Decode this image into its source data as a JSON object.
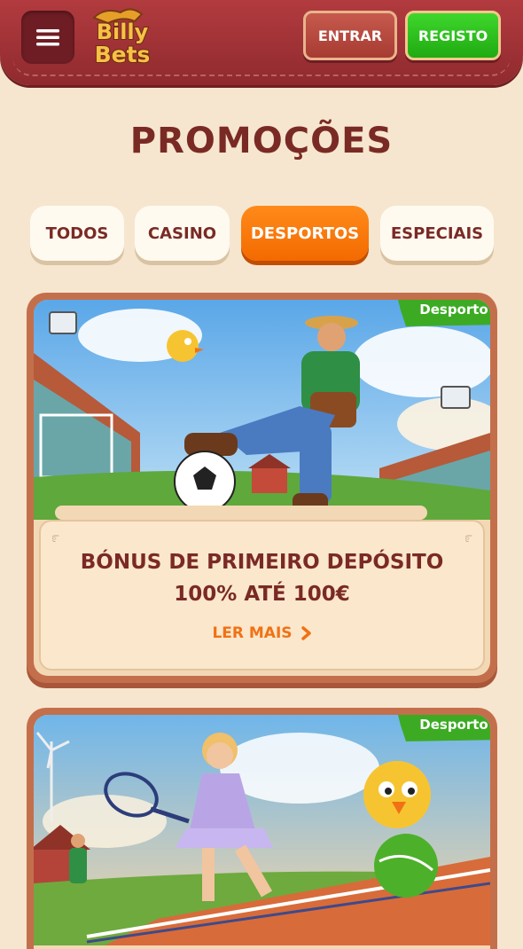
{
  "header": {
    "logo_text_line1": "Billy",
    "logo_text_line2": "Bets",
    "login_label": "ENTRAR",
    "register_label": "REGISTO"
  },
  "page": {
    "title": "PROMOÇÕES"
  },
  "tabs": [
    {
      "label": "TODOS",
      "active": false
    },
    {
      "label": "CASINO",
      "active": false
    },
    {
      "label": "DESPORTOS",
      "active": true
    },
    {
      "label": "ESPECIAIS",
      "active": false
    }
  ],
  "promotions": [
    {
      "badge": "Desporto",
      "title_line1": "BÓNUS DE PRIMEIRO DEPÓSITO",
      "title_line2": "100% ATÉ 100€",
      "cta_label": "LER MAIS",
      "image": "farmer-football-stadium"
    },
    {
      "badge": "Desporto",
      "image": "tennis-player-chick"
    }
  ],
  "colors": {
    "header": "#9e3236",
    "page_bg": "#f6e6cf",
    "title": "#7a2a25",
    "active_tab": "#f36a00",
    "register_green": "#1faa12",
    "cta_orange": "#f07214",
    "badge_green": "#3cab23"
  },
  "icons": {
    "menu": "hamburger-icon",
    "cta": "chevron-right-icon"
  }
}
